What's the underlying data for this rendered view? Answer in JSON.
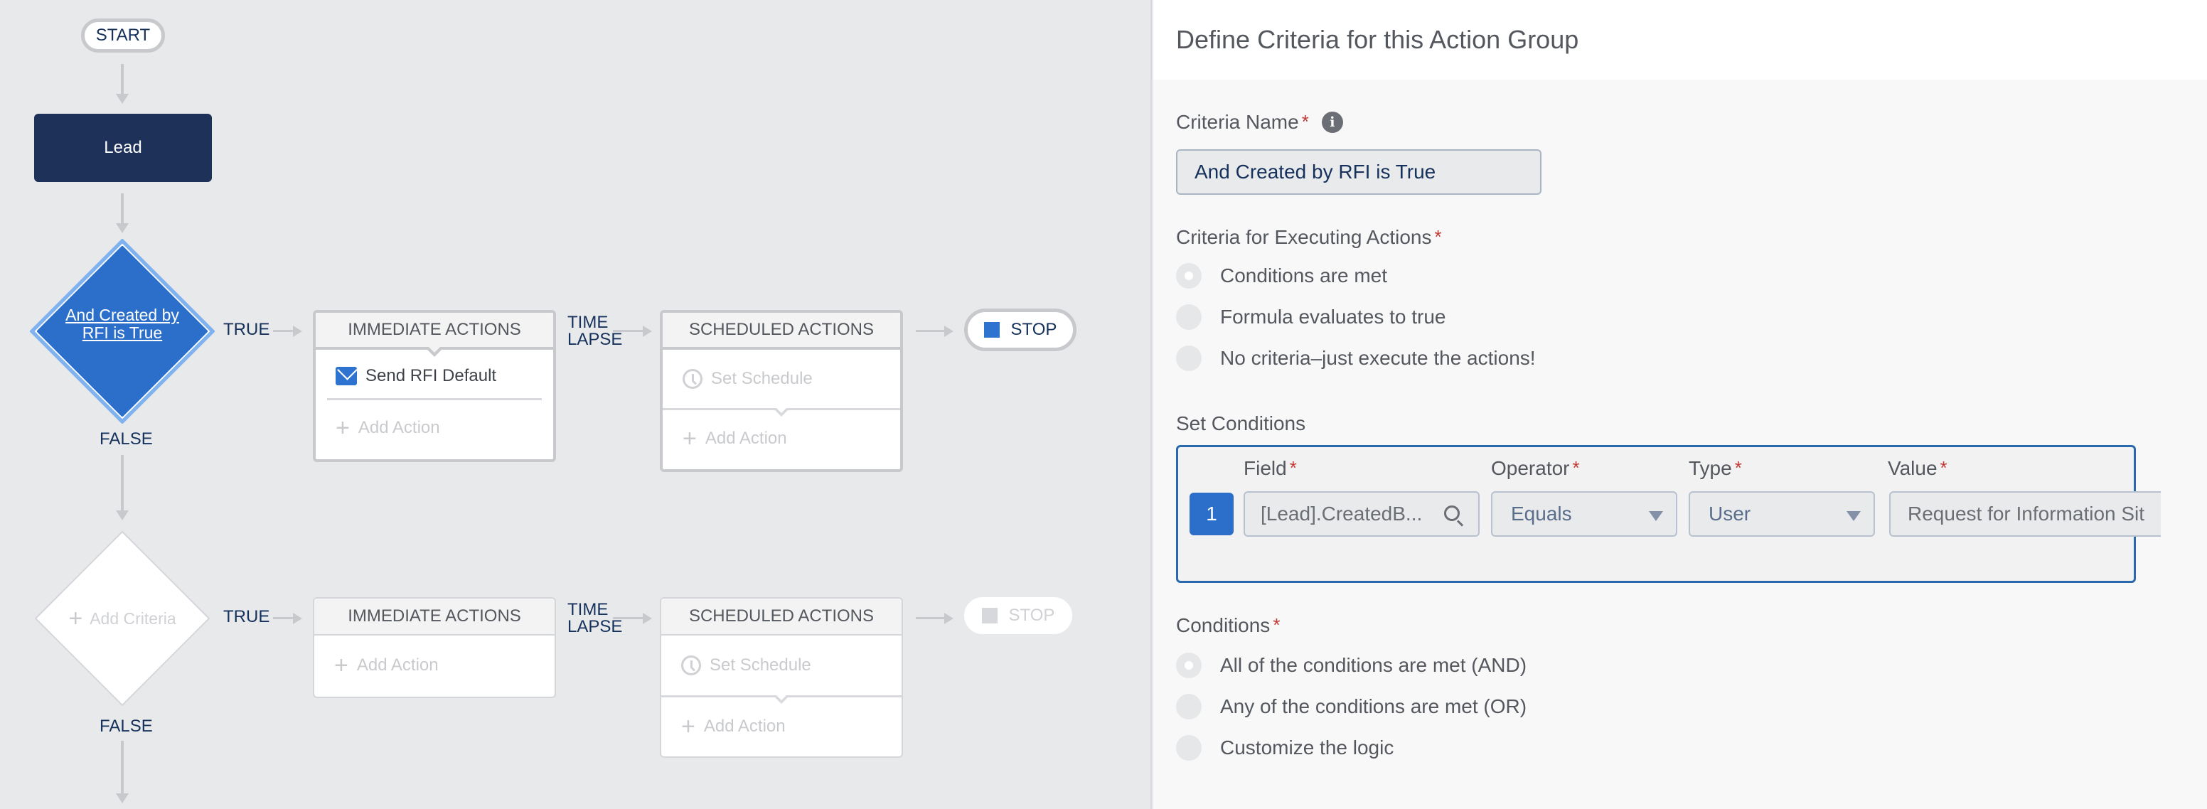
{
  "canvas": {
    "start_label": "START",
    "object_label": "Lead",
    "criteria_nodes": [
      {
        "label": "And Created by RFI is True",
        "state": "selected",
        "true_label": "TRUE",
        "false_label": "FALSE",
        "immediate_actions": {
          "header": "IMMEDIATE ACTIONS",
          "actions": [
            {
              "icon": "email-icon",
              "label": "Send RFI Default"
            }
          ],
          "add_label": "Add Action"
        },
        "time_lapse_label": "TIME\nLAPSE",
        "time_lapse_line1": "TIME",
        "time_lapse_line2": "LAPSE",
        "scheduled_actions": {
          "header": "SCHEDULED ACTIONS",
          "schedule_label": "Set Schedule",
          "add_label": "Add Action"
        },
        "stop_label": "STOP",
        "stop_active": true
      },
      {
        "label": "Add Criteria",
        "state": "placeholder",
        "true_label": "TRUE",
        "false_label": "FALSE",
        "immediate_actions": {
          "header": "IMMEDIATE ACTIONS",
          "actions": [],
          "add_label": "Add Action"
        },
        "time_lapse_line1": "TIME",
        "time_lapse_line2": "LAPSE",
        "scheduled_actions": {
          "header": "SCHEDULED ACTIONS",
          "schedule_label": "Set Schedule",
          "add_label": "Add Action"
        },
        "stop_label": "STOP",
        "stop_active": false
      }
    ]
  },
  "panel": {
    "title": "Define Criteria for this Action Group",
    "criteria_name": {
      "label": "Criteria Name",
      "required": "*",
      "info_icon": "info-icon",
      "value": "And Created by RFI is True"
    },
    "executing_criteria": {
      "label": "Criteria for Executing Actions",
      "required": "*",
      "options": [
        {
          "label": "Conditions are met",
          "selected": true
        },
        {
          "label": "Formula evaluates to true",
          "selected": false
        },
        {
          "label": "No criteria–just execute the actions!",
          "selected": false
        }
      ]
    },
    "set_conditions": {
      "label": "Set Conditions",
      "columns": [
        {
          "label": "Field",
          "required": "*"
        },
        {
          "label": "Operator",
          "required": "*"
        },
        {
          "label": "Type",
          "required": "*"
        },
        {
          "label": "Value",
          "required": "*"
        }
      ],
      "rows": [
        {
          "number": "1",
          "field": "[Lead].CreatedB...",
          "operator": "Equals",
          "type": "User",
          "value": "Request for Information Sit"
        }
      ]
    },
    "conditions": {
      "label": "Conditions",
      "required": "*",
      "options": [
        {
          "label": "All of the conditions are met (AND)",
          "selected": true
        },
        {
          "label": "Any of the conditions are met (OR)",
          "selected": false
        },
        {
          "label": "Customize the logic",
          "selected": false
        }
      ]
    }
  },
  "colors": {
    "canvas_bg": "#e8e9eb",
    "object_node": "#1e3158",
    "criteria_selected": "#2b6fcb",
    "connector": "#c8c9cc",
    "label_navy": "#16325c",
    "required_red": "#c23934",
    "conditions_border": "#2a69ad"
  }
}
